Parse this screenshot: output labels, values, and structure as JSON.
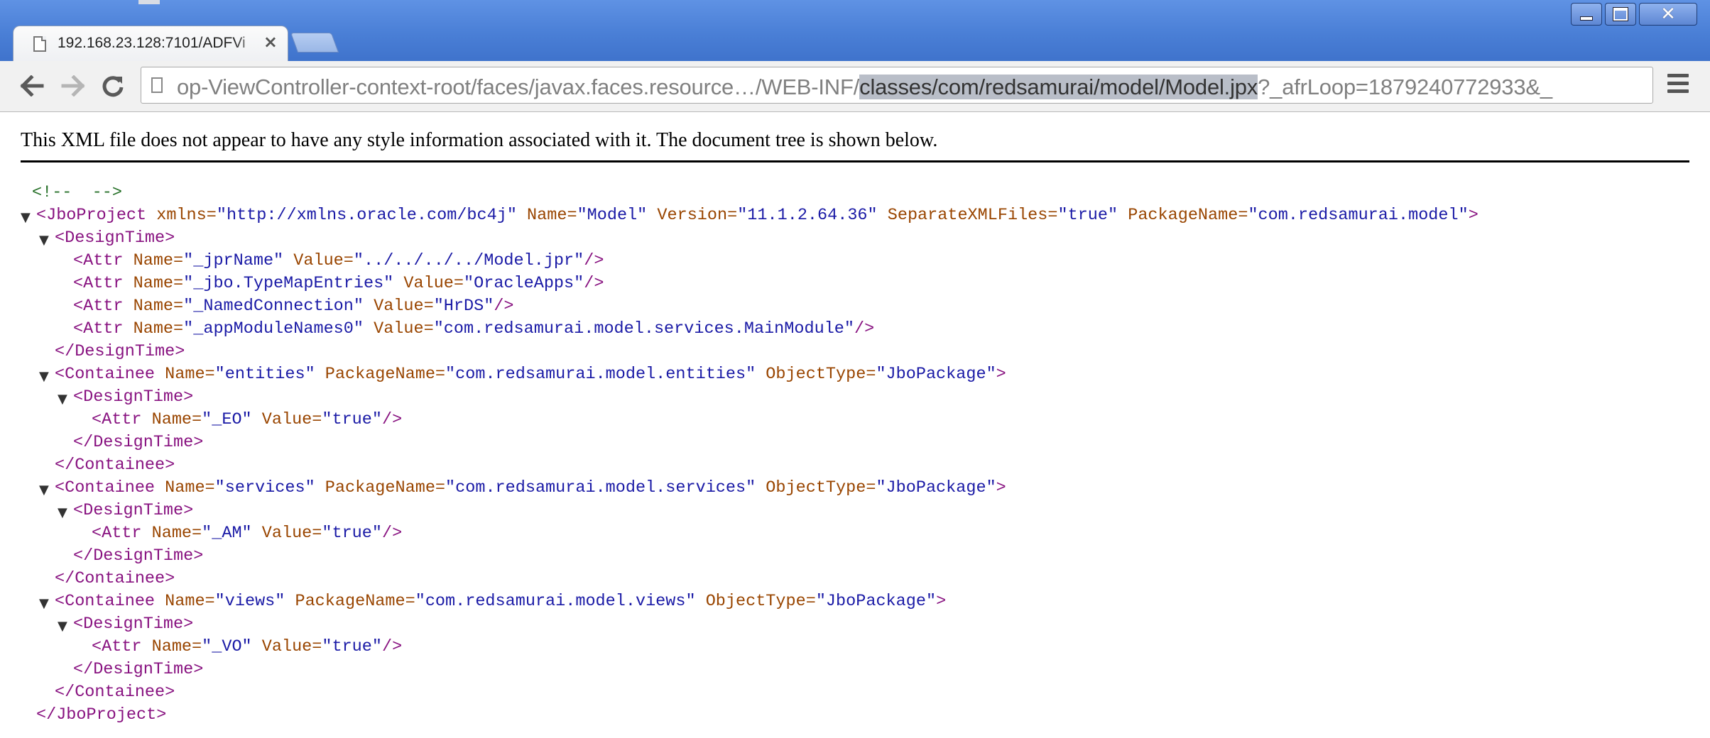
{
  "browser": {
    "tab_title": "192.168.23.128:7101/ADFVi",
    "url_prefix": "op-ViewController-context-root/faces/javax.faces.resource…/WEB-INF/",
    "url_selected": "classes/com/redsamurai/model/Model.jpx",
    "url_suffix": "?_afrLoop=1879240772933&_",
    "icons": {
      "back": "back-arrow-icon",
      "forward": "forward-arrow-icon",
      "reload": "reload-icon",
      "bookmark": "star-icon",
      "menu": "menu-icon",
      "close_tab": "close-icon"
    }
  },
  "page": {
    "notice": "This XML file does not appear to have any style information associated with it. The document tree is shown below.",
    "xml_lines": [
      {
        "indent": 0,
        "toggle": false,
        "parts": [
          {
            "t": "cmt",
            "v": "<!--  -->"
          }
        ]
      },
      {
        "indent": 0,
        "toggle": true,
        "parts": [
          {
            "t": "tag",
            "v": "<JboProject"
          },
          {
            "t": "attr",
            "v": " xmlns="
          },
          {
            "t": "val",
            "v": "\"http://xmlns.oracle.com/bc4j\""
          },
          {
            "t": "attr",
            "v": " Name="
          },
          {
            "t": "val",
            "v": "\"Model\""
          },
          {
            "t": "attr",
            "v": " Version="
          },
          {
            "t": "val",
            "v": "\"11.1.2.64.36\""
          },
          {
            "t": "attr",
            "v": " SeparateXMLFiles="
          },
          {
            "t": "val",
            "v": "\"true\""
          },
          {
            "t": "attr",
            "v": " PackageName="
          },
          {
            "t": "val",
            "v": "\"com.redsamurai.model\""
          },
          {
            "t": "tag",
            "v": ">"
          }
        ]
      },
      {
        "indent": 1,
        "toggle": true,
        "parts": [
          {
            "t": "tag",
            "v": "<DesignTime>"
          }
        ]
      },
      {
        "indent": 2,
        "toggle": false,
        "parts": [
          {
            "t": "tag",
            "v": "<Attr"
          },
          {
            "t": "attr",
            "v": " Name="
          },
          {
            "t": "val",
            "v": "\"_jprName\""
          },
          {
            "t": "attr",
            "v": " Value="
          },
          {
            "t": "val",
            "v": "\"../../../../Model.jpr\""
          },
          {
            "t": "tag",
            "v": "/>"
          }
        ]
      },
      {
        "indent": 2,
        "toggle": false,
        "parts": [
          {
            "t": "tag",
            "v": "<Attr"
          },
          {
            "t": "attr",
            "v": " Name="
          },
          {
            "t": "val",
            "v": "\"_jbo.TypeMapEntries\""
          },
          {
            "t": "attr",
            "v": " Value="
          },
          {
            "t": "val",
            "v": "\"OracleApps\""
          },
          {
            "t": "tag",
            "v": "/>"
          }
        ]
      },
      {
        "indent": 2,
        "toggle": false,
        "parts": [
          {
            "t": "tag",
            "v": "<Attr"
          },
          {
            "t": "attr",
            "v": " Name="
          },
          {
            "t": "val",
            "v": "\"_NamedConnection\""
          },
          {
            "t": "attr",
            "v": " Value="
          },
          {
            "t": "val",
            "v": "\"HrDS\""
          },
          {
            "t": "tag",
            "v": "/>"
          }
        ]
      },
      {
        "indent": 2,
        "toggle": false,
        "parts": [
          {
            "t": "tag",
            "v": "<Attr"
          },
          {
            "t": "attr",
            "v": " Name="
          },
          {
            "t": "val",
            "v": "\"_appModuleNames0\""
          },
          {
            "t": "attr",
            "v": " Value="
          },
          {
            "t": "val",
            "v": "\"com.redsamurai.model.services.MainModule\""
          },
          {
            "t": "tag",
            "v": "/>"
          }
        ]
      },
      {
        "indent": 1,
        "toggle": false,
        "parts": [
          {
            "t": "tag",
            "v": "</DesignTime>"
          }
        ]
      },
      {
        "indent": 1,
        "toggle": true,
        "parts": [
          {
            "t": "tag",
            "v": "<Containee"
          },
          {
            "t": "attr",
            "v": " Name="
          },
          {
            "t": "val",
            "v": "\"entities\""
          },
          {
            "t": "attr",
            "v": " PackageName="
          },
          {
            "t": "val",
            "v": "\"com.redsamurai.model.entities\""
          },
          {
            "t": "attr",
            "v": " ObjectType="
          },
          {
            "t": "val",
            "v": "\"JboPackage\""
          },
          {
            "t": "tag",
            "v": ">"
          }
        ]
      },
      {
        "indent": 2,
        "toggle": true,
        "parts": [
          {
            "t": "tag",
            "v": "<DesignTime>"
          }
        ]
      },
      {
        "indent": 3,
        "toggle": false,
        "parts": [
          {
            "t": "tag",
            "v": "<Attr"
          },
          {
            "t": "attr",
            "v": " Name="
          },
          {
            "t": "val",
            "v": "\"_EO\""
          },
          {
            "t": "attr",
            "v": " Value="
          },
          {
            "t": "val",
            "v": "\"true\""
          },
          {
            "t": "tag",
            "v": "/>"
          }
        ]
      },
      {
        "indent": 2,
        "toggle": false,
        "parts": [
          {
            "t": "tag",
            "v": "</DesignTime>"
          }
        ]
      },
      {
        "indent": 1,
        "toggle": false,
        "parts": [
          {
            "t": "tag",
            "v": "</Containee>"
          }
        ]
      },
      {
        "indent": 1,
        "toggle": true,
        "parts": [
          {
            "t": "tag",
            "v": "<Containee"
          },
          {
            "t": "attr",
            "v": " Name="
          },
          {
            "t": "val",
            "v": "\"services\""
          },
          {
            "t": "attr",
            "v": " PackageName="
          },
          {
            "t": "val",
            "v": "\"com.redsamurai.model.services\""
          },
          {
            "t": "attr",
            "v": " ObjectType="
          },
          {
            "t": "val",
            "v": "\"JboPackage\""
          },
          {
            "t": "tag",
            "v": ">"
          }
        ]
      },
      {
        "indent": 2,
        "toggle": true,
        "parts": [
          {
            "t": "tag",
            "v": "<DesignTime>"
          }
        ]
      },
      {
        "indent": 3,
        "toggle": false,
        "parts": [
          {
            "t": "tag",
            "v": "<Attr"
          },
          {
            "t": "attr",
            "v": " Name="
          },
          {
            "t": "val",
            "v": "\"_AM\""
          },
          {
            "t": "attr",
            "v": " Value="
          },
          {
            "t": "val",
            "v": "\"true\""
          },
          {
            "t": "tag",
            "v": "/>"
          }
        ]
      },
      {
        "indent": 2,
        "toggle": false,
        "parts": [
          {
            "t": "tag",
            "v": "</DesignTime>"
          }
        ]
      },
      {
        "indent": 1,
        "toggle": false,
        "parts": [
          {
            "t": "tag",
            "v": "</Containee>"
          }
        ]
      },
      {
        "indent": 1,
        "toggle": true,
        "parts": [
          {
            "t": "tag",
            "v": "<Containee"
          },
          {
            "t": "attr",
            "v": " Name="
          },
          {
            "t": "val",
            "v": "\"views\""
          },
          {
            "t": "attr",
            "v": " PackageName="
          },
          {
            "t": "val",
            "v": "\"com.redsamurai.model.views\""
          },
          {
            "t": "attr",
            "v": " ObjectType="
          },
          {
            "t": "val",
            "v": "\"JboPackage\""
          },
          {
            "t": "tag",
            "v": ">"
          }
        ]
      },
      {
        "indent": 2,
        "toggle": true,
        "parts": [
          {
            "t": "tag",
            "v": "<DesignTime>"
          }
        ]
      },
      {
        "indent": 3,
        "toggle": false,
        "parts": [
          {
            "t": "tag",
            "v": "<Attr"
          },
          {
            "t": "attr",
            "v": " Name="
          },
          {
            "t": "val",
            "v": "\"_VO\""
          },
          {
            "t": "attr",
            "v": " Value="
          },
          {
            "t": "val",
            "v": "\"true\""
          },
          {
            "t": "tag",
            "v": "/>"
          }
        ]
      },
      {
        "indent": 2,
        "toggle": false,
        "parts": [
          {
            "t": "tag",
            "v": "</DesignTime>"
          }
        ]
      },
      {
        "indent": 1,
        "toggle": false,
        "parts": [
          {
            "t": "tag",
            "v": "</Containee>"
          }
        ]
      },
      {
        "indent": 0,
        "toggle": false,
        "parts": [
          {
            "t": "tag",
            "v": "</JboProject>"
          }
        ]
      }
    ]
  },
  "colors": {
    "tag": "#881280",
    "attr_name": "#994500",
    "attr_value": "#1a1aa6",
    "comment": "#236e25",
    "titlebar": "#4a7fd6"
  }
}
